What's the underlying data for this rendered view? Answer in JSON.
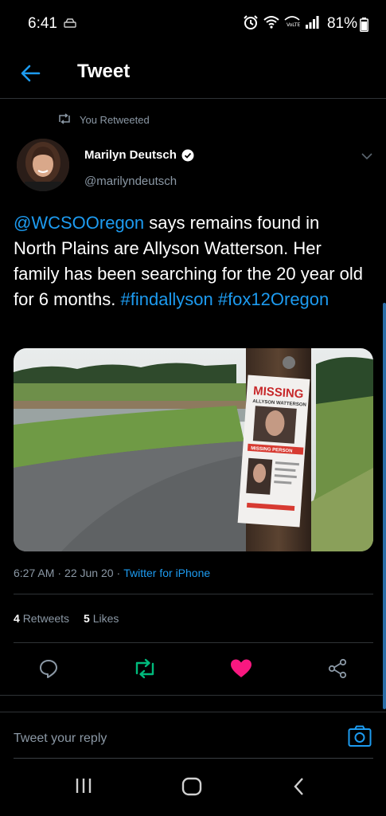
{
  "status_bar": {
    "time": "6:41",
    "battery": "81%"
  },
  "header": {
    "title": "Tweet"
  },
  "retweet_note": {
    "label": "You Retweeted"
  },
  "author": {
    "name": "Marilyn Deutsch",
    "handle": "@marilyndeutsch",
    "verified": true
  },
  "tweet": {
    "segments": [
      {
        "text": "@WCSOOregon",
        "link": true
      },
      {
        "text": " says remains found in North Plains are Allyson Watterson. Her family has been searching for the 20 year old for 6 months. ",
        "link": false
      },
      {
        "text": "#findallyson",
        "link": true
      },
      {
        "text": " ",
        "link": false
      },
      {
        "text": "#fox12Oregon",
        "link": true
      }
    ],
    "poster_text": {
      "headline": "MISSING",
      "subname": "ALLYSON WATTERSON",
      "banner": "MISSING PERSON"
    }
  },
  "meta": {
    "time": "6:27 AM",
    "date": "22 Jun 20",
    "separator": "·",
    "source": "Twitter for iPhone"
  },
  "stats": {
    "retweets_count": "4",
    "retweets_label": "Retweets",
    "likes_count": "5",
    "likes_label": "Likes"
  },
  "actions": {
    "reply_icon": "reply-icon",
    "retweet_icon": "retweet-icon",
    "like_icon": "heart-icon",
    "share_icon": "share-icon",
    "retweeted": true,
    "liked": true
  },
  "reply_bar": {
    "placeholder": "Tweet your reply"
  },
  "colors": {
    "accent": "#1d9bf0",
    "retweet_active": "#00ba7c",
    "like_active": "#f91880",
    "muted": "#8b98a5"
  }
}
